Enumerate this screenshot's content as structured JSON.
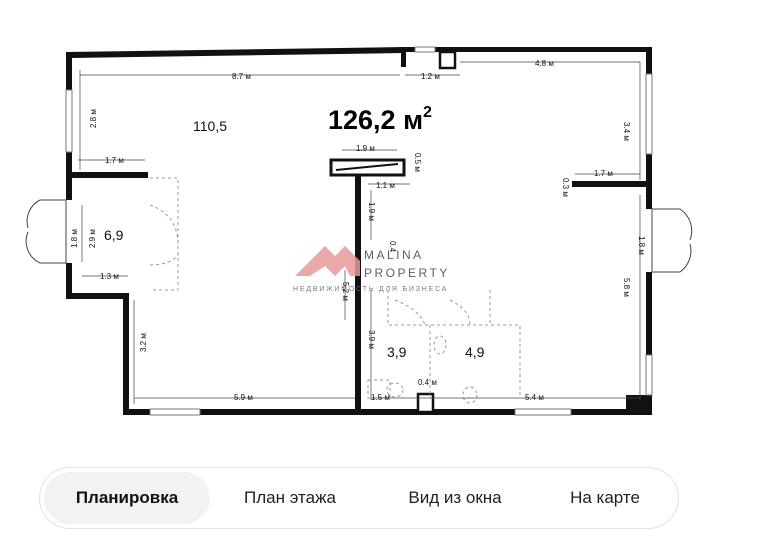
{
  "plan": {
    "total_area": "126,2 м",
    "total_area_sup": "2",
    "rooms": [
      {
        "label": "110,5"
      },
      {
        "label": "6,9"
      },
      {
        "label": "3,9"
      },
      {
        "label": "4,9"
      }
    ],
    "dimensions": {
      "d1": "8.7 м",
      "d2": "1.2 м",
      "d3": "4.8 м",
      "d4": "2.8 м",
      "d5": "3.4 м",
      "d6": "1.9 м",
      "d7": "0.5 м",
      "d8": "1.7 м",
      "d9": "1.1 м",
      "d10": "0.3 м",
      "d11": "1.7 м",
      "d12": "1.9 м",
      "d13": "1.8 м",
      "d14": "2.9 м",
      "d15": "1.8 м",
      "d16": "0.4",
      "d17": "1.3 м",
      "d18": "5.8 м",
      "d19": "3.2 м",
      "d20": "3.9 м",
      "d21": "0.4 м",
      "d22": "5.9 м",
      "d23": "1.5 м",
      "d24": "5.4 м",
      "d25": "5.2 м"
    },
    "watermark": {
      "brand_top": "MALINA",
      "brand_bottom": "PROPERTY",
      "tagline": "НЕДВИЖИМОСТЬ ДЛЯ БИЗНЕСА",
      "color": "#e8a8a8"
    }
  },
  "tabs": {
    "items": [
      {
        "label": "Планировка",
        "active": true
      },
      {
        "label": "План этажа",
        "active": false
      },
      {
        "label": "Вид из окна",
        "active": false
      },
      {
        "label": "На карте",
        "active": false
      }
    ]
  }
}
